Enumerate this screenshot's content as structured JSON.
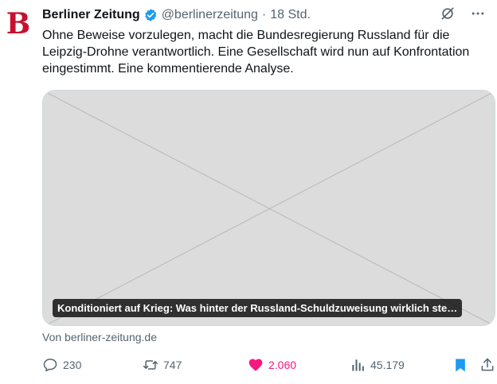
{
  "account": {
    "avatar_glyph": "B",
    "name": "Berliner Zeitung",
    "verified": true,
    "handle": "@berlinerzeitung",
    "separator": "·",
    "time": "18 Std."
  },
  "tweet": {
    "text": "Ohne Beweise vorzulegen, macht die Bundesregierung Russland für die Leipzig-Drohne verantwortlich. Eine Gesellschaft wird nun auf Konfrontation eingestimmt. Eine kommentierende Analyse."
  },
  "card": {
    "caption": "Konditioniert auf Krieg: Was hinter der Russland-Schuldzuweisung wirklich ste…",
    "source": "Von berliner-zeitung.de"
  },
  "actions": {
    "replies": "230",
    "reposts": "747",
    "likes": "2.060",
    "views": "45.179"
  },
  "icons": {
    "verified": "verified-badge-icon",
    "grok": "grok-icon",
    "more": "more-icon",
    "reply": "reply-icon",
    "repost": "repost-icon",
    "like": "heart-icon",
    "views": "views-icon",
    "bookmark": "bookmark-icon",
    "share": "share-icon"
  },
  "colors": {
    "brand": "#c8102e",
    "verified": "#1d9bf0",
    "like_active": "#f91880",
    "bookmark_active": "#1d9bf0",
    "secondary_text": "#536471"
  }
}
